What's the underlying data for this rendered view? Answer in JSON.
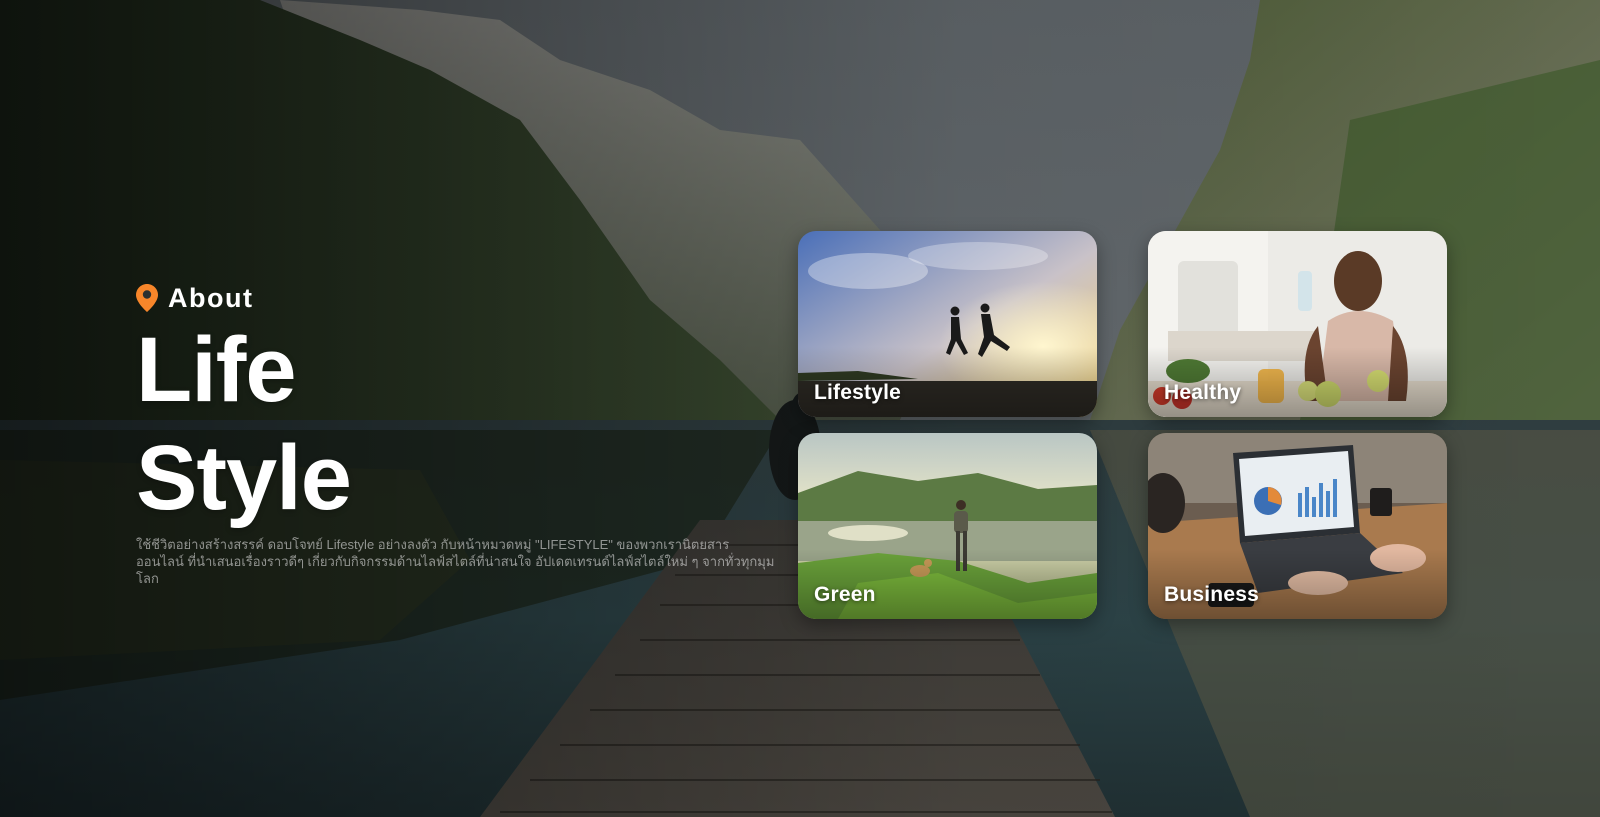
{
  "hero": {
    "eyebrow": "About",
    "title_line1": "Life",
    "title_line2": "Style",
    "description": "ใช้ชีวิตอย่างสร้างสรรค์ ดอบโจทย์ Lifestyle อย่างลงตัว กับหน้าหมวดหมู่ \"LIFESTYLE\" ของพวกเรานิตยสารออนไลน์ ที่นำเสนอเรื่องราวดีๆ เกี่ยวกับกิจกรรมด้านไลฟ์สไตล์ที่น่าสนใจ อัปเดตเทรนด์ไลฟ์สไตล์ใหม่ ๆ จากทั่วทุกมุมโลก"
  },
  "icons": {
    "eyebrow": "location-pin-icon"
  },
  "colors": {
    "accent": "#F7862A",
    "text": "#FFFFFF",
    "muted_text": "#BDBDBD"
  },
  "cards": [
    {
      "label": "Lifestyle"
    },
    {
      "label": "Healthy"
    },
    {
      "label": "Green"
    },
    {
      "label": "Business"
    }
  ]
}
